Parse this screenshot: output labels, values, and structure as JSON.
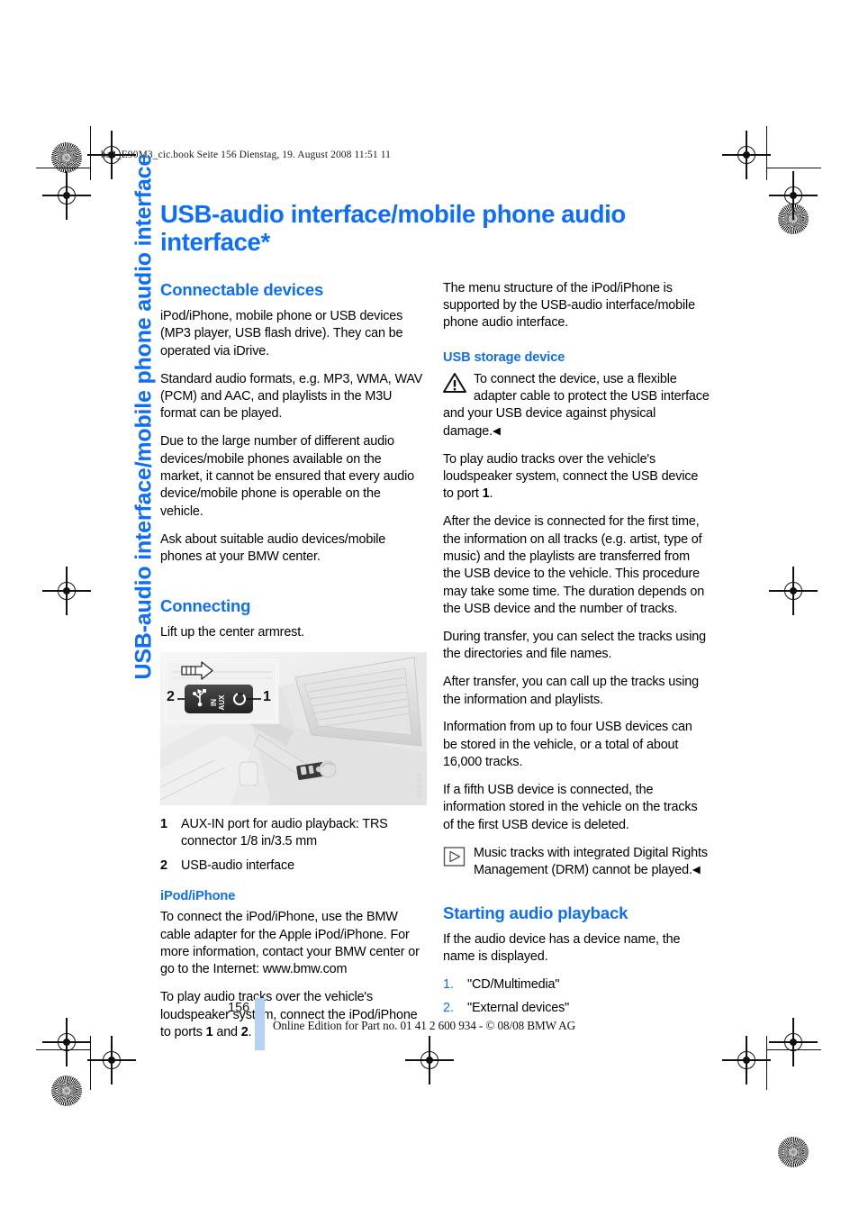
{
  "slug": "ba8_E90M3_cic.book  Seite 156  Dienstag, 19. August 2008  11:51 11",
  "side_tab": "USB-audio interface/mobile phone audio interface",
  "title": "USB-audio interface/mobile phone audio interface*",
  "left_column": {
    "heading_connectable": "Connectable devices",
    "p1": "iPod/iPhone, mobile phone or USB devices (MP3 player, USB flash drive). They can be operated via iDrive.",
    "p2": "Standard audio formats, e.g. MP3, WMA, WAV (PCM) and AAC, and playlists in the M3U format can be played.",
    "p3": "Due to the large number of different audio devices/mobile phones available on the market, it cannot be ensured that every audio device/mobile phone is operable on the vehicle.",
    "p4": "Ask about suitable audio devices/mobile phones at your BMW center.",
    "heading_connecting": "Connecting",
    "p5": "Lift up the center armrest.",
    "figure": {
      "watermark": "U5B/US",
      "callout_left": "2",
      "callout_right": "1",
      "panel_label": "AUX IN"
    },
    "legend": [
      {
        "num": "1",
        "text": "AUX-IN port for audio playback: TRS connector 1/8 in/3.5 mm"
      },
      {
        "num": "2",
        "text": "USB-audio interface"
      }
    ],
    "heading_ipod": "iPod/iPhone",
    "p6": "To connect the iPod/iPhone, use the BMW cable adapter for the Apple iPod/iPhone. For more information, contact your BMW center or go to the Internet: www.bmw.com",
    "p7_a": "To play audio tracks over the vehicle's loudspeaker system, connect the iPod/iPhone to ports ",
    "p7_b": "1",
    "p7_c": " and ",
    "p7_d": "2",
    "p7_e": "."
  },
  "right_column": {
    "p1": "The menu structure of the iPod/iPhone is supported by the USB-audio interface/mobile phone audio interface.",
    "heading_usb_storage": "USB storage device",
    "warning": "To connect the device, use a flexible adapter cable to protect the USB interface and your USB device against physical damage.",
    "warning_end": "◀",
    "p2_a": "To play audio tracks over the vehicle's loudspeaker system, connect the USB device to port ",
    "p2_b": "1",
    "p2_c": ".",
    "p3": "After the device is connected for the first time, the information on all tracks (e.g. artist, type of music) and the playlists are transferred from the USB device to the vehicle. This procedure may take some time. The duration depends on the USB device and the number of tracks.",
    "p4": "During transfer, you can select the tracks using the directories and file names.",
    "p5": "After transfer, you can call up the tracks using the information and playlists.",
    "p6": "Information from up to four USB devices can be stored in the vehicle, or a total of about 16,000 tracks.",
    "p7": "If a fifth USB device is connected, the information stored in the vehicle on the tracks of the first USB device is deleted.",
    "note": "Music tracks with integrated Digital Rights Management (DRM) cannot be played.",
    "note_end": "◀",
    "heading_starting": "Starting audio playback",
    "p8": "If the audio device has a device name, the name is displayed.",
    "steps": [
      {
        "num": "1.",
        "text": "\"CD/Multimedia\""
      },
      {
        "num": "2.",
        "text": "\"External devices\""
      }
    ]
  },
  "footer": {
    "page_number": "156",
    "text": "Online Edition for Part no. 01 41 2 600 934 - © 08/08 BMW AG"
  },
  "colors": {
    "accent_blue": "#0d6efd",
    "bar_blue": "#b6d2f2"
  }
}
